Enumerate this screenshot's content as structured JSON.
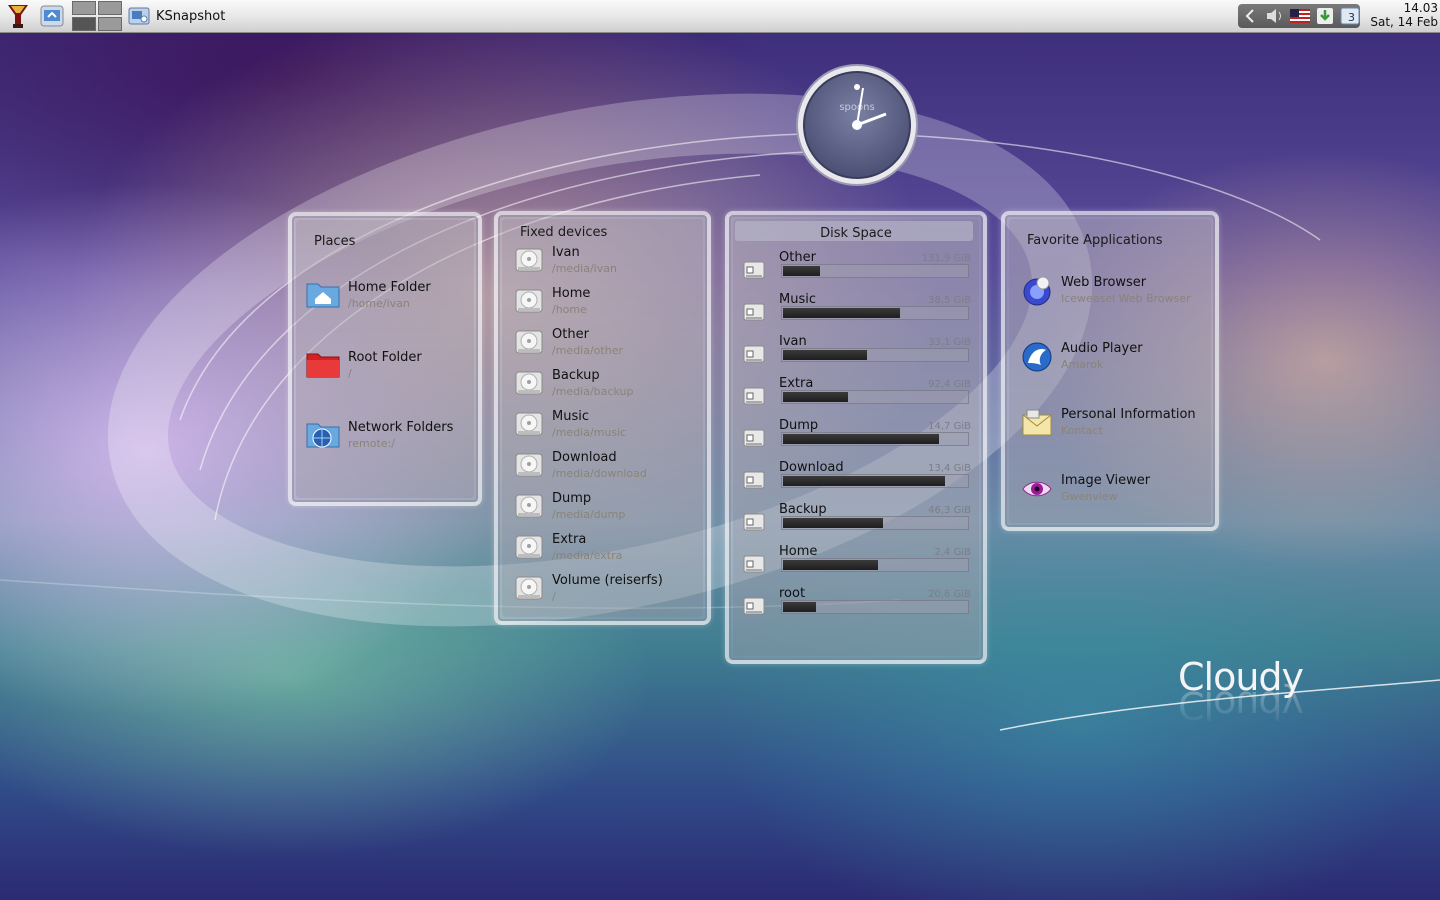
{
  "taskbar": {
    "task_label": "KSnapshot",
    "clock_time": "14.03",
    "clock_date": "Sat, 14 Feb"
  },
  "clock_widget": {
    "label": "spoons"
  },
  "places": {
    "title": "Places",
    "items": [
      {
        "name": "Home Folder",
        "path": "/home/ivan",
        "icon": "home-folder-icon"
      },
      {
        "name": "Root Folder",
        "path": "/",
        "icon": "red-folder-icon"
      },
      {
        "name": "Network Folders",
        "path": "remote:/",
        "icon": "network-folder-icon"
      }
    ]
  },
  "fixed_devices": {
    "title": "Fixed devices",
    "items": [
      {
        "name": "Ivan",
        "path": "/media/ivan"
      },
      {
        "name": "Home",
        "path": "/home"
      },
      {
        "name": "Other",
        "path": "/media/other"
      },
      {
        "name": "Backup",
        "path": "/media/backup"
      },
      {
        "name": "Music",
        "path": "/media/music"
      },
      {
        "name": "Download",
        "path": "/media/download"
      },
      {
        "name": "Dump",
        "path": "/media/dump"
      },
      {
        "name": "Extra",
        "path": "/media/extra"
      },
      {
        "name": "Volume (reiserfs)",
        "path": "/"
      }
    ]
  },
  "disk_space": {
    "title": "Disk Space",
    "items": [
      {
        "name": "Other",
        "size": "131,9 GiB",
        "used_fraction": 0.2
      },
      {
        "name": "Music",
        "size": "38,5 GiB",
        "used_fraction": 0.63
      },
      {
        "name": "Ivan",
        "size": "33,1 GiB",
        "used_fraction": 0.45
      },
      {
        "name": "Extra",
        "size": "92,4 GiB",
        "used_fraction": 0.35
      },
      {
        "name": "Dump",
        "size": "14,7 GiB",
        "used_fraction": 0.84
      },
      {
        "name": "Download",
        "size": "13,4 GiB",
        "used_fraction": 0.87
      },
      {
        "name": "Backup",
        "size": "46,3 GiB",
        "used_fraction": 0.54
      },
      {
        "name": "Home",
        "size": "2,4 GiB",
        "used_fraction": 0.51
      },
      {
        "name": "root",
        "size": "20,6 GiB",
        "used_fraction": 0.18
      }
    ]
  },
  "favorites": {
    "title": "Favorite Applications",
    "items": [
      {
        "name": "Web Browser",
        "app": "Iceweasel Web Browser",
        "icon": "web-browser-icon"
      },
      {
        "name": "Audio Player",
        "app": "Amarok",
        "icon": "audio-player-icon"
      },
      {
        "name": "Personal Information",
        "app": "Kontact",
        "icon": "personal-information-icon"
      },
      {
        "name": "Image Viewer",
        "app": "Gwenview",
        "icon": "image-viewer-icon"
      }
    ]
  },
  "brand": {
    "text": "Cloudy"
  },
  "colors": {
    "taskbar": "#e6e6e6",
    "bar_fill": "#2a2a2a",
    "subtext": "#8a8378"
  }
}
